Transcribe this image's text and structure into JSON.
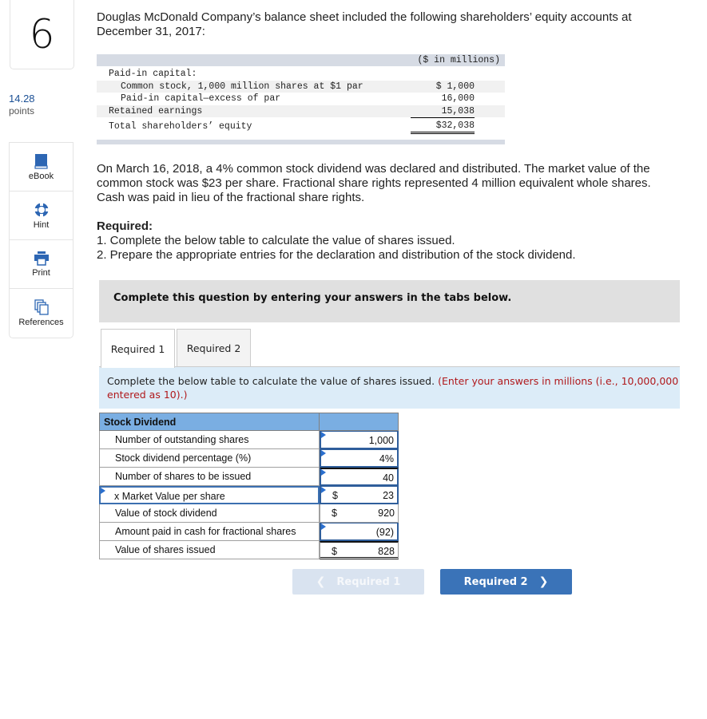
{
  "question": {
    "number": "6",
    "points_value": "14.28",
    "points_label": "points"
  },
  "tools": [
    {
      "label": "eBook",
      "icon": "book-icon"
    },
    {
      "label": "Hint",
      "icon": "lifebuoy-icon"
    },
    {
      "label": "Print",
      "icon": "printer-icon"
    },
    {
      "label": "References",
      "icon": "documents-icon"
    }
  ],
  "intro": "Douglas McDonald Company’s balance sheet included the following shareholders’ equity accounts at December 31, 2017:",
  "balance_sheet": {
    "units": "($ in millions)",
    "rows": [
      {
        "label": "Paid-in capital:",
        "amount": ""
      },
      {
        "label": "Common stock, 1,000 million shares at $1 par",
        "amount": "$ 1,000"
      },
      {
        "label": "Paid-in capital—excess of par",
        "amount": "16,000"
      },
      {
        "label": "Retained earnings",
        "amount": "15,038"
      },
      {
        "label": "Total shareholders’ equity",
        "amount": "$32,038"
      }
    ]
  },
  "scenario": "On March 16, 2018, a 4% common stock dividend was declared and distributed. The market value of the common stock was $23 per share. Fractional share rights represented 4 million equivalent whole shares. Cash was paid in lieu of the fractional share rights.",
  "required": {
    "heading": "Required:",
    "items": [
      "1. Complete the below table to calculate the value of shares issued.",
      "2. Prepare the appropriate entries for the declaration and distribution of the stock dividend."
    ]
  },
  "banner": "Complete this question by entering your answers in the tabs below.",
  "tabs": [
    {
      "label": "Required 1",
      "active": true
    },
    {
      "label": "Required 2",
      "active": false
    }
  ],
  "instruction": {
    "text": "Complete the below table to calculate the value of shares issued.",
    "note_line1": "(Enter your answers in millions (i.e., 10,000,000 should be",
    "note_line2": "entered as 10).)"
  },
  "stock_dividend_table": {
    "header": "Stock Dividend",
    "rows": [
      {
        "label": "Number of outstanding shares",
        "dollar": "",
        "value": "1,000",
        "input": true
      },
      {
        "label": "Stock dividend percentage (%)",
        "dollar": "",
        "value": "4%",
        "input": true
      },
      {
        "label": "Number of shares to be issued",
        "dollar": "",
        "value": "40",
        "input": true
      },
      {
        "label": "x Market Value per share",
        "dollar": "$",
        "value": "23",
        "input": true
      },
      {
        "label": "Value of stock dividend",
        "dollar": "$",
        "value": "920",
        "input": false
      },
      {
        "label": "Amount paid in cash for fractional shares",
        "dollar": "",
        "value": "(92)",
        "input": true
      },
      {
        "label": "Value of shares issued",
        "dollar": "$",
        "value": "828",
        "input": false
      }
    ]
  },
  "nav": {
    "prev_label": "Required 1",
    "next_label": "Required 2",
    "prev_enabled": false,
    "colors": {
      "next_bg": "#3a73b8",
      "prev_bg": "#d9e3f0"
    }
  }
}
